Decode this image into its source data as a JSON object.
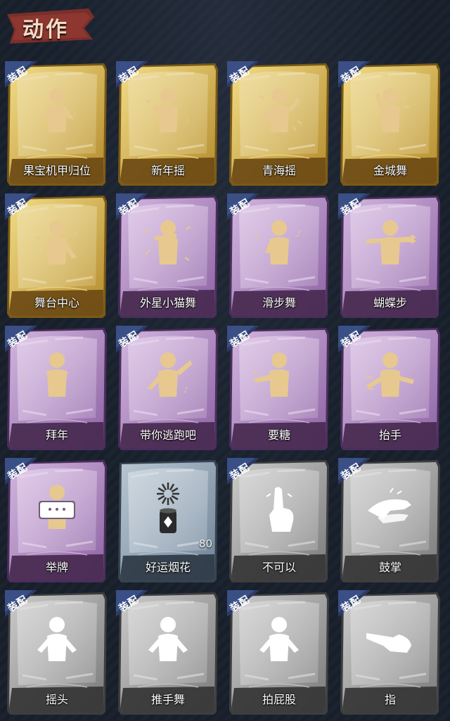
{
  "header": {
    "title": "动作"
  },
  "equip_label": "装配",
  "tier_colors": {
    "gold": {
      "c1": "#f2dc86",
      "c2": "#b48b2d",
      "edge": "#7a5a16",
      "pane": "#efe2b4",
      "band": "#6b4a14",
      "fig": "#e7c98f"
    },
    "purple": {
      "c1": "#d2b6df",
      "c2": "#8d63a3",
      "edge": "#4b2e5c",
      "pane": "#eadbf0",
      "band": "#47294f",
      "fig": "#e7c98f"
    },
    "blue": {
      "c1": "#b9c6d2",
      "c2": "#6f8397",
      "edge": "#364452",
      "pane": "#dde4ea",
      "band": "#2e3945",
      "fig": "#eef3f7"
    },
    "gray": {
      "c1": "#cbcbcb",
      "c2": "#7a7a7a",
      "edge": "#3e3e3e",
      "pane": "#e2e2e2",
      "band": "#353535",
      "fig": "#ffffff"
    }
  },
  "cards": [
    {
      "label": "果宝机甲归位",
      "tier": "gold",
      "equip": true,
      "icon": "figure-hands-chest-icon"
    },
    {
      "label": "新年摇",
      "tier": "gold",
      "equip": true,
      "icon": "figure-clasped-hands-icon"
    },
    {
      "label": "青海摇",
      "tier": "gold",
      "equip": true,
      "icon": "figure-dance-icon"
    },
    {
      "label": "金城舞",
      "tier": "gold",
      "equip": true,
      "icon": "figure-hand-up-icon"
    },
    {
      "label": "舞台中心",
      "tier": "gold",
      "equip": true,
      "icon": "figure-pose-icon"
    },
    {
      "label": "外星小猫舞",
      "tier": "purple",
      "equip": true,
      "icon": "figure-cat-dance-icon"
    },
    {
      "label": "滑步舞",
      "tier": "purple",
      "equip": true,
      "icon": "figure-slide-step-icon"
    },
    {
      "label": "蝴蝶步",
      "tier": "purple",
      "equip": true,
      "icon": "figure-arms-out-icon"
    },
    {
      "label": "拜年",
      "tier": "purple",
      "equip": true,
      "icon": "figure-bow-greeting-icon"
    },
    {
      "label": "带你逃跑吧",
      "tier": "purple",
      "equip": true,
      "icon": "figure-point-run-icon"
    },
    {
      "label": "要糖",
      "tier": "purple",
      "equip": true,
      "icon": "figure-reach-out-icon"
    },
    {
      "label": "抬手",
      "tier": "purple",
      "equip": true,
      "icon": "figure-raise-hands-icon"
    },
    {
      "label": "举牌",
      "tier": "purple",
      "equip": true,
      "icon": "figure-sign-icon"
    },
    {
      "label": "好运烟花",
      "tier": "blue",
      "equip": false,
      "icon": "firework-icon",
      "count": "80"
    },
    {
      "label": "不可以",
      "tier": "gray",
      "equip": true,
      "icon": "finger-no-icon"
    },
    {
      "label": "鼓掌",
      "tier": "gray",
      "equip": true,
      "icon": "clap-hands-icon"
    },
    {
      "label": "摇头",
      "tier": "gray",
      "equip": true,
      "icon": "figure-shake-head-icon"
    },
    {
      "label": "推手舞",
      "tier": "gray",
      "equip": true,
      "icon": "figure-push-hands-icon"
    },
    {
      "label": "拍屁股",
      "tier": "gray",
      "equip": true,
      "icon": "figure-bend-icon"
    },
    {
      "label": "指",
      "tier": "gray",
      "equip": true,
      "icon": "pointing-hand-icon"
    }
  ]
}
